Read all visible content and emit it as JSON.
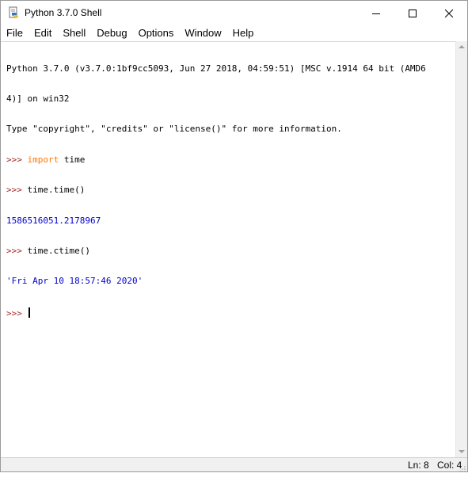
{
  "window": {
    "title": "Python 3.7.0 Shell",
    "app_icon": "python-idle-icon"
  },
  "controls": {
    "minimize_icon": "minimize-icon",
    "maximize_icon": "maximize-icon",
    "close_icon": "close-icon"
  },
  "menu": {
    "items": [
      "File",
      "Edit",
      "Shell",
      "Debug",
      "Options",
      "Window",
      "Help"
    ]
  },
  "shell": {
    "banner_line1": "Python 3.7.0 (v3.7.0:1bf9cc5093, Jun 27 2018, 04:59:51) [MSC v.1914 64 bit (AMD6",
    "banner_line2": "4)] on win32",
    "banner_line3": "Type \"copyright\", \"credits\" or \"license()\" for more information.",
    "prompt": ">>> ",
    "cmd1_keyword": "import",
    "cmd1_rest": " time",
    "cmd2": "time.time()",
    "out2": "1586516051.2178967",
    "cmd3": "time.ctime()",
    "out3": "'Fri Apr 10 18:57:46 2020'"
  },
  "colors": {
    "prompt": "#a52a2a",
    "keyword": "#ff7700",
    "output": "#0000cc",
    "string": "#008000"
  },
  "status": {
    "line": "Ln: 8",
    "col": "Col: 4"
  }
}
